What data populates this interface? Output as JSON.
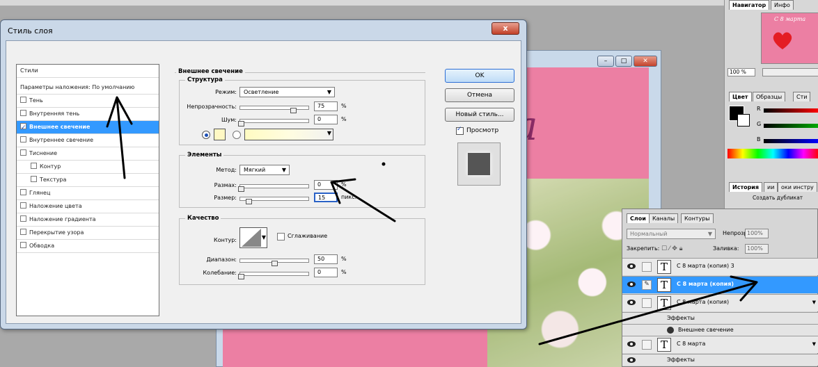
{
  "dialog": {
    "title": "Стиль слоя",
    "close_label": "x"
  },
  "styles_list": {
    "header": "Стили",
    "items": [
      {
        "label": "Параметры наложения: По умолчанию",
        "type": "plain"
      },
      {
        "label": "Тень",
        "checked": false
      },
      {
        "label": "Внутренняя тень",
        "checked": false
      },
      {
        "label": "Внешнее свечение",
        "checked": true,
        "selected": true
      },
      {
        "label": "Внутреннее свечение",
        "checked": false
      },
      {
        "label": "Тиснение",
        "checked": false
      },
      {
        "label": "Контур",
        "checked": false,
        "sub": true
      },
      {
        "label": "Текстура",
        "checked": false,
        "sub": true
      },
      {
        "label": "Глянец",
        "checked": false
      },
      {
        "label": "Наложение цвета",
        "checked": false
      },
      {
        "label": "Наложение градиента",
        "checked": false
      },
      {
        "label": "Перекрытие узора",
        "checked": false
      },
      {
        "label": "Обводка",
        "checked": false
      }
    ]
  },
  "outer_glow": {
    "title": "Внешнее свечение",
    "structure": {
      "title": "Структура",
      "mode_label": "Режим:",
      "mode_value": "Осветление",
      "opacity_label": "Непрозрачность:",
      "opacity_value": "75",
      "noise_label": "Шум:",
      "noise_value": "0",
      "percent": "%"
    },
    "elements": {
      "title": "Элементы",
      "method_label": "Метод:",
      "method_value": "Мягкий",
      "spread_label": "Размах:",
      "spread_value": "0",
      "size_label": "Размер:",
      "size_value": "15",
      "size_unit": "пикс.",
      "percent": "%"
    },
    "quality": {
      "title": "Качество",
      "contour_label": "Контур:",
      "antialias_label": "Сглаживание",
      "range_label": "Диапазон:",
      "range_value": "50",
      "jitter_label": "Колебание:",
      "jitter_value": "0",
      "percent": "%"
    }
  },
  "buttons": {
    "ok": "OK",
    "cancel": "Отмена",
    "new_style": "Новый стиль...",
    "preview": "Просмотр"
  },
  "right_panel": {
    "navigator_tabs": [
      "Навигатор",
      "Инфо"
    ],
    "zoom": "100 %",
    "thumb_text": "С 8 марта",
    "color_tabs": [
      "Цвет",
      "Образцы",
      "Сти"
    ],
    "channels": [
      "R",
      "G",
      "B"
    ],
    "history_tabs": [
      "История",
      "ии",
      "оки инстру"
    ],
    "history_item": "Создать дубликат"
  },
  "layers": {
    "tabs": [
      "Слои",
      "Каналы",
      "Контуры"
    ],
    "blend_mode": "Нормальный",
    "opacity_label": "Непрозр.:",
    "opacity_value": "100%",
    "lock_label": "Закрепить:",
    "fill_label": "Заливка:",
    "fill_value": "100%",
    "rows": [
      {
        "name": "С 8 марта (копия) 3",
        "kind": "text"
      },
      {
        "name": "С 8 марта (копия)",
        "kind": "text",
        "selected": true
      },
      {
        "name": "С 8 марта (копия)",
        "kind": "text"
      },
      {
        "name": "Эффекты",
        "kind": "sub"
      },
      {
        "name": "Внешнее свечение",
        "kind": "sub-effect"
      },
      {
        "name": "С 8 марта",
        "kind": "text"
      },
      {
        "name": "Эффекты",
        "kind": "sub"
      }
    ],
    "thumb_glyph": "T"
  },
  "document": {
    "canvas_script": "a"
  },
  "colors": {
    "selection": "#3399ff",
    "canvas_pink": "#ec7fa3",
    "glow_swatch": "#fff8c4"
  }
}
